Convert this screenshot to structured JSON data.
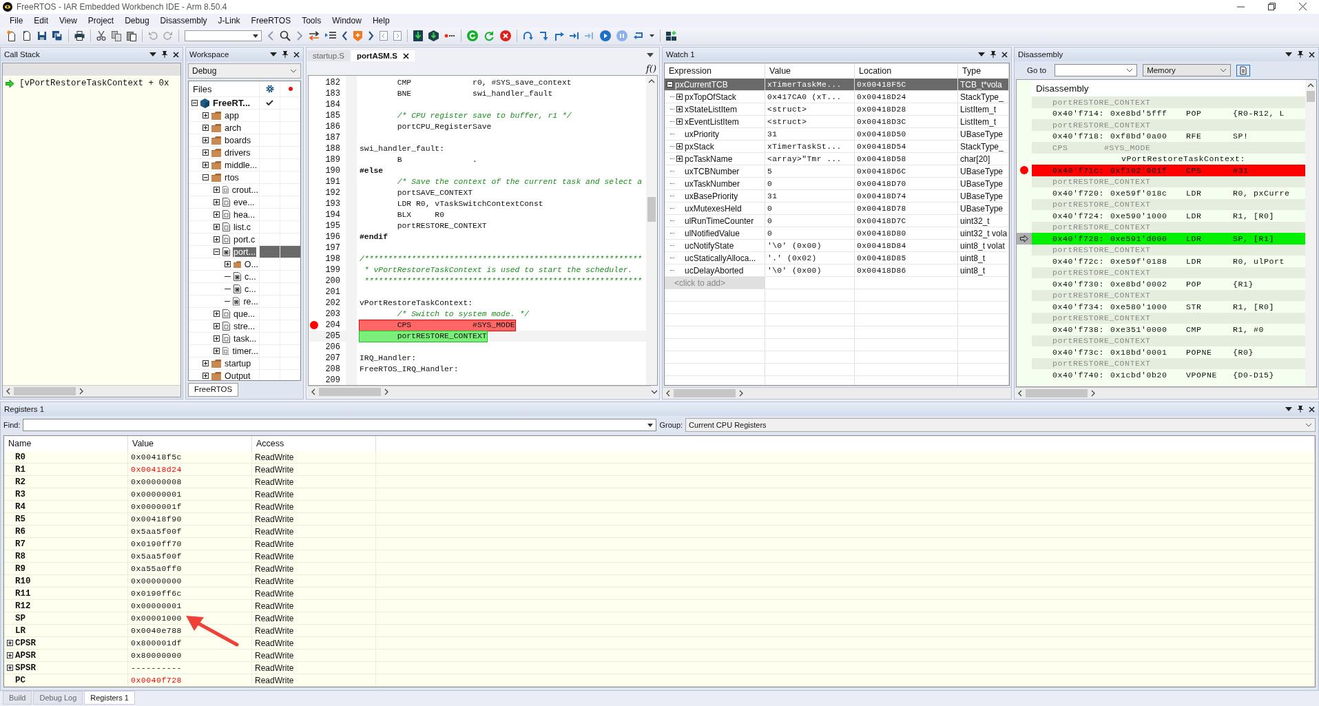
{
  "window": {
    "title": "FreeRTOS - IAR Embedded Workbench IDE - Arm 8.50.4"
  },
  "menu": [
    "File",
    "Edit",
    "View",
    "Project",
    "Debug",
    "Disassembly",
    "J-Link",
    "FreeRTOS",
    "Tools",
    "Window",
    "Help"
  ],
  "call_stack": {
    "title": "Call Stack",
    "frames": [
      {
        "text": "[vPortRestoreTaskContext + 0x",
        "current": true
      }
    ]
  },
  "workspace": {
    "title": "Workspace",
    "configuration": "Debug",
    "files_heading": "Files",
    "tab": "FreeRTOS",
    "tree": [
      {
        "name": "FreeRT...",
        "kind": "project",
        "expanded": true,
        "selected": false,
        "checked": true,
        "children": [
          {
            "name": "app",
            "kind": "folder",
            "expanded": false,
            "selected": false
          },
          {
            "name": "arch",
            "kind": "folder",
            "expanded": false,
            "selected": false
          },
          {
            "name": "boards",
            "kind": "folder",
            "expanded": false,
            "selected": false
          },
          {
            "name": "drivers",
            "kind": "folder",
            "expanded": false,
            "selected": false
          },
          {
            "name": "middle...",
            "kind": "folder",
            "expanded": false,
            "selected": false
          },
          {
            "name": "rtos",
            "kind": "folder",
            "expanded": true,
            "selected": false,
            "children": [
              {
                "name": "crout...",
                "kind": "source",
                "expanded": false,
                "selected": false
              },
              {
                "name": "eve...",
                "kind": "source",
                "expanded": false,
                "selected": false
              },
              {
                "name": "hea...",
                "kind": "source",
                "expanded": false,
                "selected": false
              },
              {
                "name": "list.c",
                "kind": "source",
                "expanded": false,
                "selected": false
              },
              {
                "name": "port.c",
                "kind": "source",
                "expanded": false,
                "selected": false
              },
              {
                "name": "port...",
                "kind": "assembly",
                "expanded": true,
                "selected": true,
                "children": [
                  {
                    "name": "O...",
                    "kind": "folder",
                    "expanded": false,
                    "selected": false
                  },
                  {
                    "name": "c...",
                    "kind": "config",
                    "selected": false
                  },
                  {
                    "name": "c...",
                    "kind": "header",
                    "selected": false
                  },
                  {
                    "name": "re...",
                    "kind": "header",
                    "selected": false
                  }
                ]
              },
              {
                "name": "que...",
                "kind": "source",
                "expanded": false,
                "selected": false
              },
              {
                "name": "stre...",
                "kind": "source",
                "expanded": false,
                "selected": false
              },
              {
                "name": "task...",
                "kind": "source",
                "expanded": false,
                "selected": false
              },
              {
                "name": "timer...",
                "kind": "source",
                "expanded": false,
                "selected": false
              }
            ]
          },
          {
            "name": "startup",
            "kind": "folder",
            "expanded": false,
            "selected": false
          },
          {
            "name": "Output",
            "kind": "folder",
            "expanded": false,
            "selected": false
          }
        ]
      }
    ]
  },
  "editor": {
    "tabs": [
      {
        "label": "startup.S",
        "selected": false
      },
      {
        "label": "portASM.S",
        "selected": true
      }
    ],
    "function_icon": "f()",
    "lines": [
      {
        "number": "182",
        "kind": "code",
        "breakpoint": false,
        "current": false,
        "text": "        CMP             r0, #SYS_save_context"
      },
      {
        "number": "183",
        "kind": "code",
        "breakpoint": false,
        "current": false,
        "text": "        BNE             swi_handler_fault"
      },
      {
        "number": "184",
        "kind": "blank",
        "breakpoint": false,
        "current": false
      },
      {
        "number": "185",
        "kind": "comment",
        "breakpoint": false,
        "current": false,
        "text": "        /* CPU register save to buffer, r1 */"
      },
      {
        "number": "186",
        "kind": "code",
        "breakpoint": false,
        "current": false,
        "text": "        portCPU_RegisterSave"
      },
      {
        "number": "187",
        "kind": "blank",
        "breakpoint": false,
        "current": false
      },
      {
        "number": "188",
        "kind": "code",
        "breakpoint": false,
        "current": false,
        "text": "swi_handler_fault:"
      },
      {
        "number": "189",
        "kind": "code",
        "breakpoint": false,
        "current": false,
        "text": "        B               ."
      },
      {
        "number": "190",
        "kind": "directive",
        "breakpoint": false,
        "current": false,
        "text": "#else"
      },
      {
        "number": "191",
        "kind": "comment",
        "breakpoint": false,
        "current": false,
        "text": "        /* Save the context of the current task and select a"
      },
      {
        "number": "192",
        "kind": "code",
        "breakpoint": false,
        "current": false,
        "text": "        portSAVE_CONTEXT"
      },
      {
        "number": "193",
        "kind": "code",
        "breakpoint": false,
        "current": false,
        "text": "        LDR R0, vTaskSwitchContextConst"
      },
      {
        "number": "194",
        "kind": "code",
        "breakpoint": false,
        "current": false,
        "text": "        BLX     R0"
      },
      {
        "number": "195",
        "kind": "code",
        "breakpoint": false,
        "current": false,
        "text": "        portRESTORE_CONTEXT"
      },
      {
        "number": "196",
        "kind": "directive",
        "breakpoint": false,
        "current": false,
        "text": "#endif"
      },
      {
        "number": "197",
        "kind": "blank",
        "breakpoint": false,
        "current": false
      },
      {
        "number": "198",
        "kind": "comment",
        "breakpoint": false,
        "current": false,
        "text": "/***********************************************************"
      },
      {
        "number": "199",
        "kind": "comment",
        "breakpoint": false,
        "current": false,
        "text": " * vPortRestoreTaskContext is used to start the scheduler."
      },
      {
        "number": "200",
        "kind": "comment",
        "breakpoint": false,
        "current": false,
        "text": " ***********************************************************"
      },
      {
        "number": "201",
        "kind": "blank",
        "breakpoint": false,
        "current": false
      },
      {
        "number": "202",
        "kind": "code",
        "breakpoint": false,
        "current": false,
        "text": "vPortRestoreTaskContext:"
      },
      {
        "number": "203",
        "kind": "comment",
        "breakpoint": false,
        "current": false,
        "text": "        /* Switch to system mode. */"
      },
      {
        "number": "204",
        "kind": "code",
        "breakpoint": true,
        "current": false,
        "text": "        CPS             #SYS_MODE"
      },
      {
        "number": "205",
        "kind": "code",
        "breakpoint": false,
        "current": true,
        "text": "        portRESTORE_CONTEXT"
      },
      {
        "number": "206",
        "kind": "blank",
        "breakpoint": false,
        "current": false
      },
      {
        "number": "207",
        "kind": "code",
        "breakpoint": false,
        "current": false,
        "text": "IRQ_Handler:"
      },
      {
        "number": "208",
        "kind": "code",
        "breakpoint": false,
        "current": false,
        "text": "FreeRTOS_IRQ_Handler:"
      },
      {
        "number": "209",
        "kind": "blank",
        "breakpoint": false,
        "current": false
      }
    ]
  },
  "watch": {
    "title": "Watch 1",
    "columns": [
      "Expression",
      "Value",
      "Location",
      "Type"
    ],
    "add_row": "<click to add>",
    "rows": [
      {
        "expression": "pxCurrentTCB",
        "value": "xTimerTaskMe...",
        "location": "0x00418F5C",
        "type": "TCB_t*vola",
        "expanded": true,
        "selected": true,
        "children": [
          {
            "expression": "pxTopOfStack",
            "value": "0x417CA0 (xT...",
            "location": "0x00418D24",
            "type": "StackType_",
            "expanded": false
          },
          {
            "expression": "xStateListItem",
            "value": "<struct>",
            "location": "0x00418D28",
            "type": "ListItem_t",
            "expanded": false
          },
          {
            "expression": "xEventListItem",
            "value": "<struct>",
            "location": "0x00418D3C",
            "type": "ListItem_t",
            "expanded": false
          },
          {
            "expression": "uxPriority",
            "value": "31",
            "location": "0x00418D50",
            "type": "UBaseType"
          },
          {
            "expression": "pxStack",
            "value": "xTimerTaskSt...",
            "location": "0x00418D54",
            "type": "StackType_",
            "expanded": false
          },
          {
            "expression": "pcTaskName",
            "value": "<array>\"Tmr ...",
            "location": "0x00418D58",
            "type": "char[20]",
            "expanded": false
          },
          {
            "expression": "uxTCBNumber",
            "value": "5",
            "location": "0x00418D6C",
            "type": "UBaseType"
          },
          {
            "expression": "uxTaskNumber",
            "value": "0",
            "location": "0x00418D70",
            "type": "UBaseType"
          },
          {
            "expression": "uxBasePriority",
            "value": "31",
            "location": "0x00418D74",
            "type": "UBaseType"
          },
          {
            "expression": "uxMutexesHeld",
            "value": "0",
            "location": "0x00418D78",
            "type": "UBaseType"
          },
          {
            "expression": "ulRunTimeCounter",
            "value": "0",
            "location": "0x00418D7C",
            "type": "uint32_t"
          },
          {
            "expression": "ulNotifiedValue",
            "value": "0",
            "location": "0x00418D80",
            "type": "uint32_t vola"
          },
          {
            "expression": "ucNotifyState",
            "value": "'\\0' (0x00)",
            "location": "0x00418D84",
            "type": "uint8_t volat"
          },
          {
            "expression": "ucStaticallyAlloca...",
            "value": "'.' (0x02)",
            "location": "0x00418D85",
            "type": "uint8_t"
          },
          {
            "expression": "ucDelayAborted",
            "value": "'\\0' (0x00)",
            "location": "0x00418D86",
            "type": "uint8_t"
          }
        ]
      }
    ]
  },
  "disassembly": {
    "title": "Disassembly",
    "goto_label": "Go to",
    "view": "Memory",
    "heading": "Disassembly",
    "rows": [
      {
        "kind": "source",
        "breakpoint": false,
        "current": false,
        "text": "portRESTORE_CONTEXT"
      },
      {
        "kind": "instruction",
        "breakpoint": false,
        "current": false,
        "address": "0x40'f714:",
        "opcode": "0xe8bd'5fff",
        "mnemonic": "POP",
        "operands": "{R0-R12, L"
      },
      {
        "kind": "source",
        "breakpoint": false,
        "current": false,
        "text": "portRESTORE_CONTEXT"
      },
      {
        "kind": "instruction",
        "breakpoint": false,
        "current": false,
        "address": "0x40'f718:",
        "opcode": "0xf8bd'0a00",
        "mnemonic": "RFE",
        "operands": "SP!"
      },
      {
        "kind": "source",
        "breakpoint": false,
        "current": false,
        "text": "CPS       #SYS_MODE"
      },
      {
        "kind": "label",
        "breakpoint": false,
        "current": false,
        "text": "vPortRestoreTaskContext:"
      },
      {
        "kind": "instruction",
        "breakpoint": true,
        "current": false,
        "address": "0x40'f71c:",
        "opcode": "0xf102'001f",
        "mnemonic": "CPS",
        "operands": "#31"
      },
      {
        "kind": "source",
        "breakpoint": false,
        "current": false,
        "text": "portRESTORE_CONTEXT"
      },
      {
        "kind": "instruction",
        "breakpoint": false,
        "current": false,
        "address": "0x40'f720:",
        "opcode": "0xe59f'018c",
        "mnemonic": "LDR",
        "operands": "R0, pxCurre"
      },
      {
        "kind": "source",
        "breakpoint": false,
        "current": false,
        "text": "portRESTORE_CONTEXT"
      },
      {
        "kind": "instruction",
        "breakpoint": false,
        "current": false,
        "address": "0x40'f724:",
        "opcode": "0xe590'1000",
        "mnemonic": "LDR",
        "operands": "R1, [R0]"
      },
      {
        "kind": "source",
        "breakpoint": false,
        "current": false,
        "text": "portRESTORE_CONTEXT"
      },
      {
        "kind": "instruction",
        "breakpoint": false,
        "current": true,
        "address": "0x40'f728:",
        "opcode": "0xe591'd000",
        "mnemonic": "LDR",
        "operands": "SP, [R1]"
      },
      {
        "kind": "source",
        "breakpoint": false,
        "current": false,
        "text": "portRESTORE_CONTEXT"
      },
      {
        "kind": "instruction",
        "breakpoint": false,
        "current": false,
        "address": "0x40'f72c:",
        "opcode": "0xe59f'0188",
        "mnemonic": "LDR",
        "operands": "R0, ulPort"
      },
      {
        "kind": "source",
        "breakpoint": false,
        "current": false,
        "text": "portRESTORE_CONTEXT"
      },
      {
        "kind": "instruction",
        "breakpoint": false,
        "current": false,
        "address": "0x40'f730:",
        "opcode": "0xe8bd'0002",
        "mnemonic": "POP",
        "operands": "{R1}"
      },
      {
        "kind": "source",
        "breakpoint": false,
        "current": false,
        "text": "portRESTORE_CONTEXT"
      },
      {
        "kind": "instruction",
        "breakpoint": false,
        "current": false,
        "address": "0x40'f734:",
        "opcode": "0xe580'1000",
        "mnemonic": "STR",
        "operands": "R1, [R0]"
      },
      {
        "kind": "source",
        "breakpoint": false,
        "current": false,
        "text": "portRESTORE_CONTEXT"
      },
      {
        "kind": "instruction",
        "breakpoint": false,
        "current": false,
        "address": "0x40'f738:",
        "opcode": "0xe351'0000",
        "mnemonic": "CMP",
        "operands": "R1, #0"
      },
      {
        "kind": "source",
        "breakpoint": false,
        "current": false,
        "text": "portRESTORE_CONTEXT"
      },
      {
        "kind": "instruction",
        "breakpoint": false,
        "current": false,
        "address": "0x40'f73c:",
        "opcode": "0x18bd'0001",
        "mnemonic": "POPNE",
        "operands": "{R0}"
      },
      {
        "kind": "source",
        "breakpoint": false,
        "current": false,
        "text": "portRESTORE_CONTEXT"
      },
      {
        "kind": "instruction",
        "breakpoint": false,
        "current": false,
        "address": "0x40'f740:",
        "opcode": "0x1cbd'0b20",
        "mnemonic": "VPOPNE",
        "operands": "{D0-D15}"
      }
    ]
  },
  "registers": {
    "title": "Registers 1",
    "find_label": "Find:",
    "group_label": "Group:",
    "group": "Current CPU Registers",
    "columns": [
      "Name",
      "Value",
      "Access"
    ],
    "rows": [
      {
        "name": "R0",
        "value": "0x00418f5c",
        "access": "ReadWrite",
        "changed": false
      },
      {
        "name": "R1",
        "value": "0x00418d24",
        "access": "ReadWrite",
        "changed": true
      },
      {
        "name": "R2",
        "value": "0x00000008",
        "access": "ReadWrite",
        "changed": false
      },
      {
        "name": "R3",
        "value": "0x00000001",
        "access": "ReadWrite",
        "changed": false
      },
      {
        "name": "R4",
        "value": "0x0000001f",
        "access": "ReadWrite",
        "changed": false
      },
      {
        "name": "R5",
        "value": "0x00418f90",
        "access": "ReadWrite",
        "changed": false
      },
      {
        "name": "R6",
        "value": "0x5aa5f00f",
        "access": "ReadWrite",
        "changed": false
      },
      {
        "name": "R7",
        "value": "0x0190ff70",
        "access": "ReadWrite",
        "changed": false
      },
      {
        "name": "R8",
        "value": "0x5aa5f00f",
        "access": "ReadWrite",
        "changed": false
      },
      {
        "name": "R9",
        "value": "0xa55a0ff0",
        "access": "ReadWrite",
        "changed": false
      },
      {
        "name": "R10",
        "value": "0x00000000",
        "access": "ReadWrite",
        "changed": false
      },
      {
        "name": "R11",
        "value": "0x0190ff6c",
        "access": "ReadWrite",
        "changed": false
      },
      {
        "name": "R12",
        "value": "0x00000001",
        "access": "ReadWrite",
        "changed": false
      },
      {
        "name": "SP",
        "value": "0x00001000",
        "access": "ReadWrite",
        "changed": false
      },
      {
        "name": "LR",
        "value": "0x0040e788",
        "access": "ReadWrite",
        "changed": false
      },
      {
        "name": "CPSR",
        "value": "0x800001df",
        "access": "ReadWrite",
        "changed": false,
        "expanded": false
      },
      {
        "name": "APSR",
        "value": "0x80000000",
        "access": "ReadWrite",
        "changed": false,
        "expanded": false
      },
      {
        "name": "SPSR",
        "value": "----------",
        "access": "ReadWrite",
        "changed": false,
        "expanded": false
      },
      {
        "name": "PC",
        "value": "0x0040f728",
        "access": "ReadWrite",
        "changed": true
      }
    ]
  },
  "bottom_tabs": [
    {
      "label": "Build",
      "selected": false
    },
    {
      "label": "Debug Log",
      "selected": false
    },
    {
      "label": "Registers 1",
      "selected": true
    }
  ]
}
